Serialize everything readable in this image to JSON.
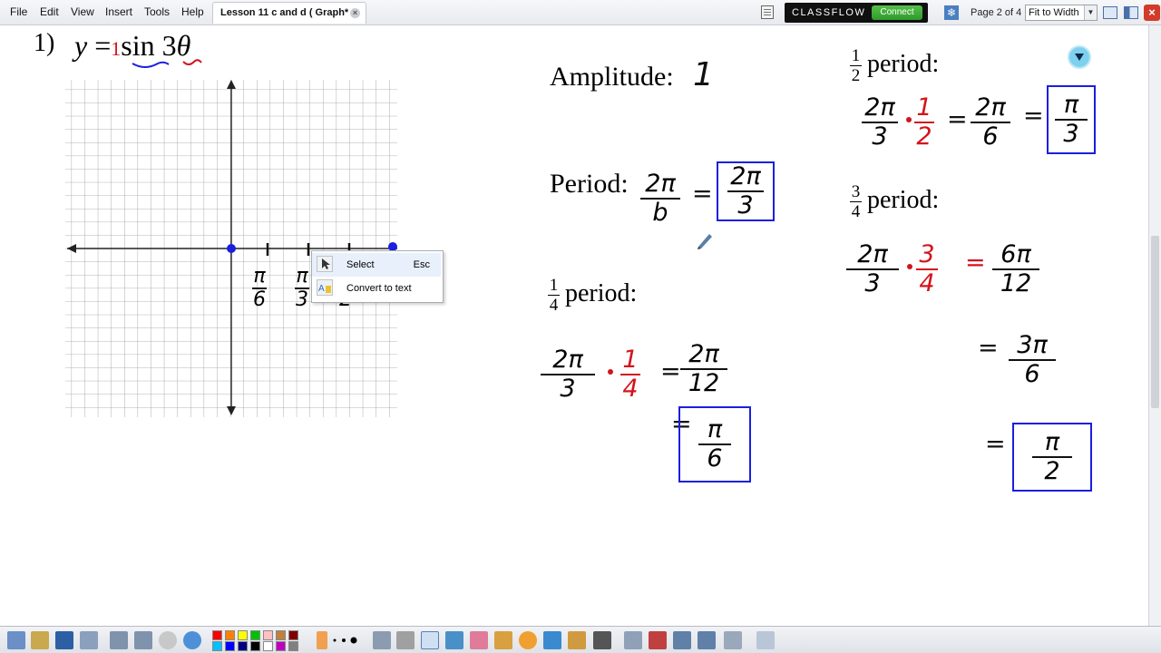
{
  "menu": {
    "items": [
      "File",
      "Edit",
      "View",
      "Insert",
      "Tools",
      "Help"
    ],
    "tab_title": "Lesson 11 c and d ( Graph*",
    "tab_close_glyph": "×"
  },
  "classflow": {
    "logo": "CLASSFLOW",
    "connect_label": "Connect"
  },
  "toolbar_right": {
    "page_indicator": "Page 2 of 4",
    "zoom_value": "Fit to Width",
    "zoom_arrow": "▼",
    "close_glyph": "×",
    "snow_glyph": "❄"
  },
  "problem": {
    "number": "1)",
    "equation_y": "y",
    "equation_eq": "=",
    "equation_amp": "1",
    "equation_fn": "sin",
    "equation_coef": "3",
    "equation_var": "θ"
  },
  "graph": {
    "tick_labels": [
      {
        "num": "π",
        "den": "6"
      },
      {
        "num": "π",
        "den": "3"
      },
      {
        "num": "π",
        "den": "2"
      }
    ]
  },
  "context_menu": {
    "items": [
      {
        "label": "Select",
        "shortcut": "Esc"
      },
      {
        "label": "Convert to text",
        "shortcut": ""
      }
    ]
  },
  "amplitude": {
    "label": "Amplitude:",
    "value": "1"
  },
  "period": {
    "label": "Period:",
    "num1": "2π",
    "den1": "b",
    "eq": "=",
    "num2": "2π",
    "den2": "3"
  },
  "quarter_period": {
    "label_num": "1",
    "label_den": "4",
    "label": "period:",
    "a_num": "2π",
    "a_den": "3",
    "b_num": "1",
    "b_den": "4",
    "c_num": "2π",
    "c_den": "12",
    "ans_num": "π",
    "ans_den": "6",
    "eq": "="
  },
  "half_period": {
    "label_num": "1",
    "label_den": "2",
    "label": "period:",
    "a_num": "2π",
    "a_den": "3",
    "b_num": "1",
    "b_den": "2",
    "c_num": "2π",
    "c_den": "6",
    "ans_num": "π",
    "ans_den": "3",
    "eq": "="
  },
  "three_quarter_period": {
    "label_num": "3",
    "label_den": "4",
    "label": "period:",
    "a_num": "2π",
    "a_den": "3",
    "b_num": "3",
    "b_den": "4",
    "c_num": "6π",
    "c_den": "12",
    "d_num": "3π",
    "d_den": "6",
    "ans_num": "π",
    "ans_den": "2",
    "eq": "="
  },
  "colors": {
    "ink_blue": "#1a1fe0",
    "ink_red": "#d3141b",
    "connect_green": "#3aa832",
    "pagelink_cyan": "#7fd0ef"
  },
  "bottom_toolbar": {
    "palette": [
      "#ff0000",
      "#ff8000",
      "#ffff00",
      "#00c000",
      "#ffc0c0",
      "#c08040",
      "#800000",
      "#00c0ff",
      "#0000ff",
      "#000080",
      "#000000",
      "#ffffff",
      "#c000c0",
      "#808080"
    ]
  }
}
